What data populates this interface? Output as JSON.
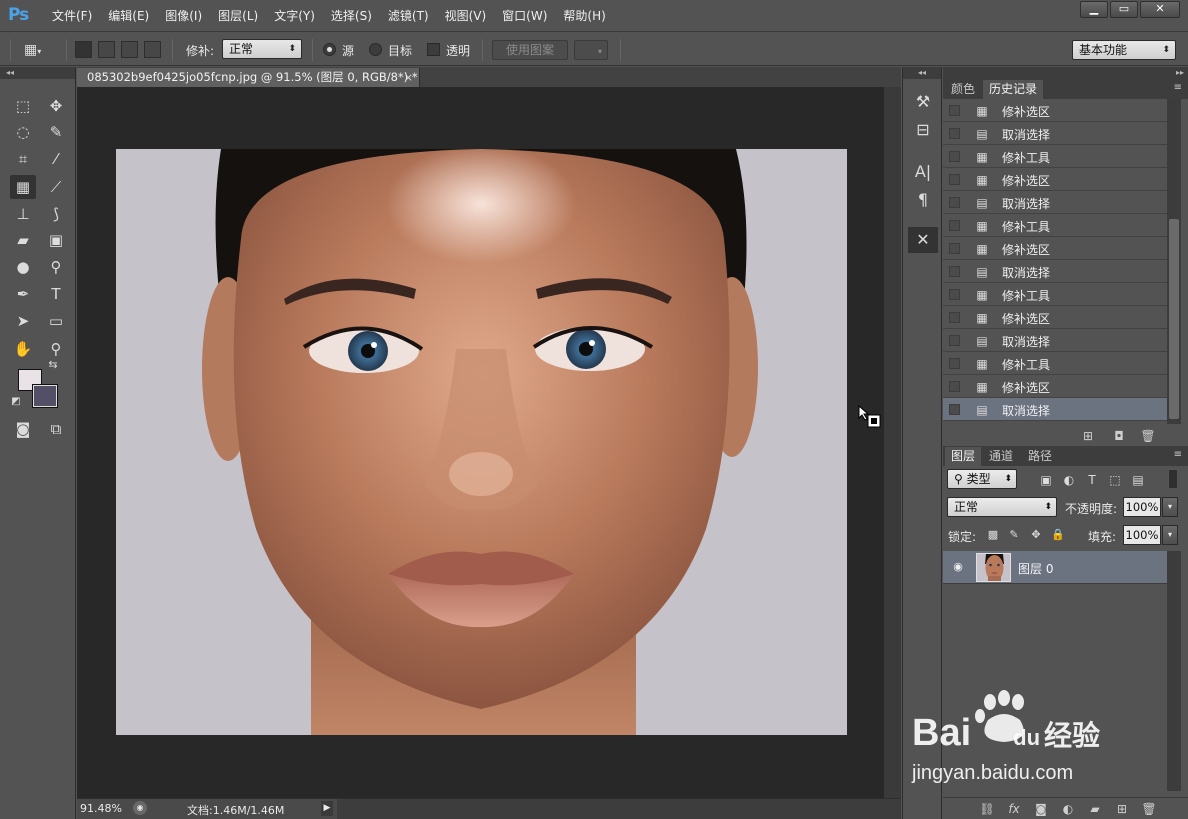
{
  "app": {
    "logo": "Ps"
  },
  "menu": [
    "文件(F)",
    "编辑(E)",
    "图像(I)",
    "图层(L)",
    "文字(Y)",
    "选择(S)",
    "滤镜(T)",
    "视图(V)",
    "窗口(W)",
    "帮助(H)"
  ],
  "options": {
    "patch_label": "修补:",
    "patch_mode": "正常",
    "source_label": "源",
    "dest_label": "目标",
    "transparent_label": "透明",
    "use_pattern": "使用图案",
    "workspace": "基本功能"
  },
  "document": {
    "tab_title": "085302b9ef0425jo05fcnp.jpg @ 91.5% (图层 0, RGB/8*) *",
    "close_glyph": "×",
    "zoom": "91.48%",
    "doc_info": "文档:1.46M/1.46M"
  },
  "panels": {
    "top_tabs": [
      "颜色",
      "历史记录"
    ],
    "history": [
      {
        "label": "修补选区",
        "icon": "patch-icon"
      },
      {
        "label": "取消选择",
        "icon": "document-icon"
      },
      {
        "label": "修补工具",
        "icon": "patch-icon"
      },
      {
        "label": "修补选区",
        "icon": "patch-icon"
      },
      {
        "label": "取消选择",
        "icon": "document-icon"
      },
      {
        "label": "修补工具",
        "icon": "patch-icon"
      },
      {
        "label": "修补选区",
        "icon": "patch-icon"
      },
      {
        "label": "取消选择",
        "icon": "document-icon"
      },
      {
        "label": "修补工具",
        "icon": "patch-icon"
      },
      {
        "label": "修补选区",
        "icon": "patch-icon"
      },
      {
        "label": "取消选择",
        "icon": "document-icon"
      },
      {
        "label": "修补工具",
        "icon": "patch-icon"
      },
      {
        "label": "修补选区",
        "icon": "patch-icon"
      },
      {
        "label": "取消选择",
        "icon": "document-icon"
      }
    ],
    "layer_tabs": [
      "图层",
      "通道",
      "路径"
    ],
    "filter_kind": "类型",
    "blend_mode": "正常",
    "opacity_label": "不透明度:",
    "opacity": "100%",
    "lock_label": "锁定:",
    "fill_label": "填充:",
    "fill": "100%",
    "layer_name": "图层 0"
  },
  "colors": {
    "foreground": "#e9e2e6",
    "background": "#524f66",
    "accent": "#4aa3e8"
  },
  "watermark": {
    "brand": "Bai",
    "brand2": "du",
    "suffix": "经验",
    "url": "jingyan.baidu.com"
  }
}
